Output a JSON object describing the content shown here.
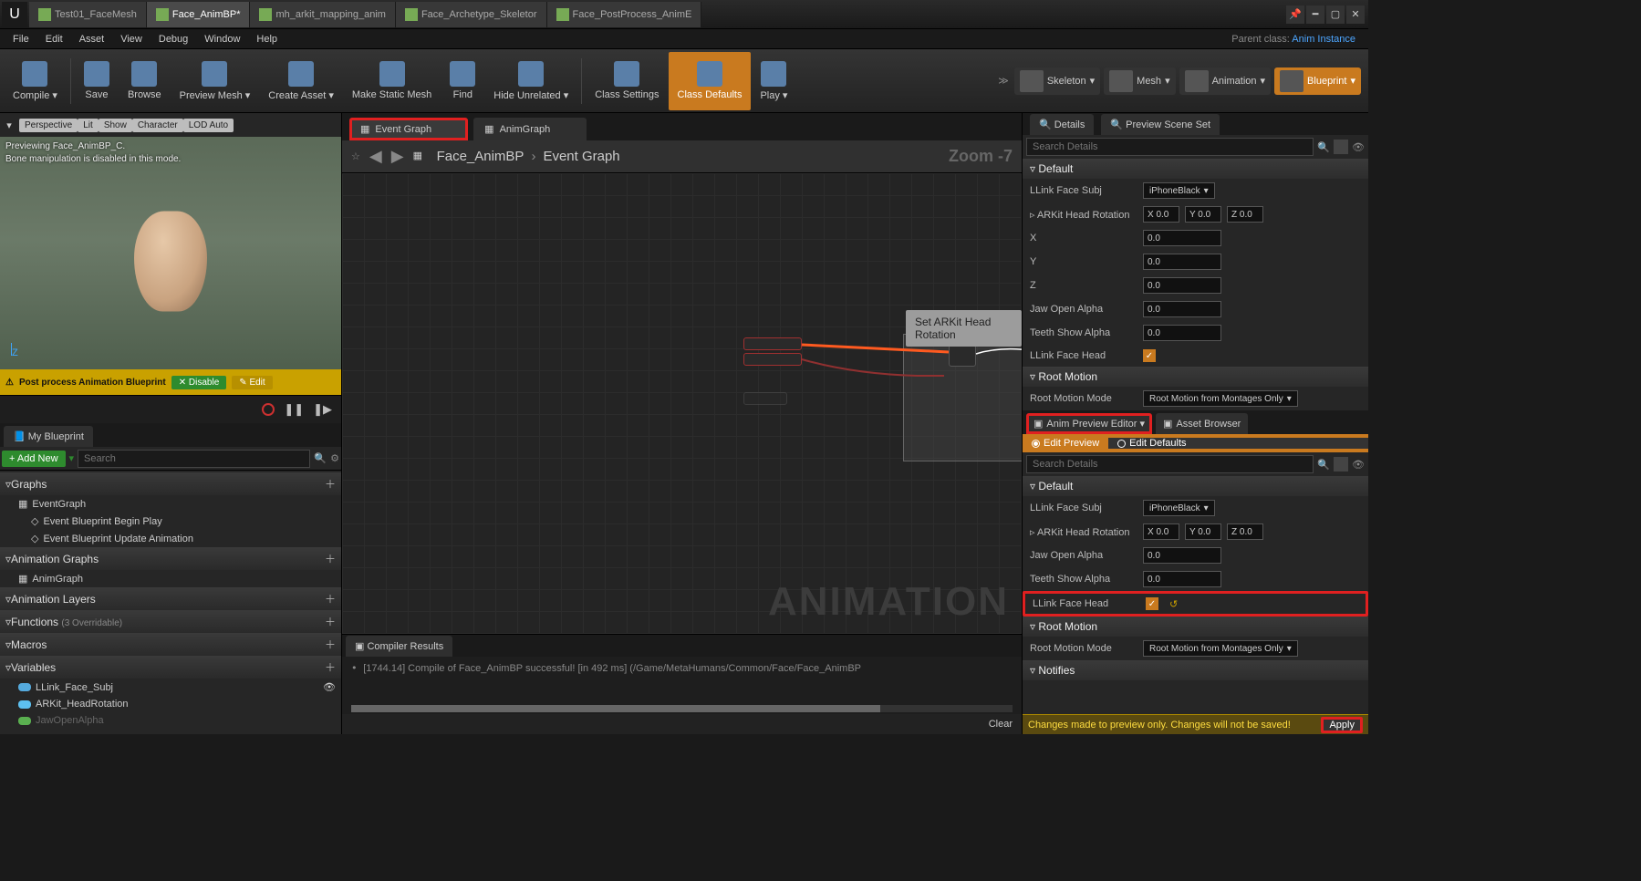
{
  "titleTabs": [
    "Test01_FaceMesh",
    "Face_AnimBP*",
    "mh_arkit_mapping_anim",
    "Face_Archetype_Skeletor",
    "Face_PostProcess_AnimE"
  ],
  "activeTitleTab": 1,
  "menus": [
    "File",
    "Edit",
    "Asset",
    "View",
    "Debug",
    "Window",
    "Help"
  ],
  "parentLabel": "Parent class:",
  "parentLink": "Anim Instance",
  "toolbar": [
    {
      "label": "Compile",
      "drop": true
    },
    {
      "label": "Save"
    },
    {
      "label": "Browse"
    },
    {
      "label": "Preview Mesh",
      "drop": true
    },
    {
      "label": "Create Asset",
      "drop": true
    },
    {
      "label": "Make Static Mesh"
    },
    {
      "label": "Find"
    },
    {
      "label": "Hide Unrelated",
      "drop": true
    },
    {
      "label": "Class Settings"
    },
    {
      "label": "Class Defaults",
      "orange": true
    },
    {
      "label": "Play",
      "drop": true
    }
  ],
  "modes": [
    {
      "label": "Skeleton"
    },
    {
      "label": "Mesh"
    },
    {
      "label": "Animation"
    },
    {
      "label": "Blueprint",
      "active": true
    }
  ],
  "viewport": {
    "chips": [
      "Perspective",
      "Lit",
      "Show",
      "Character",
      "LOD Auto"
    ],
    "overlay1": "Previewing Face_AnimBP_C.",
    "overlay2": "Bone manipulation is disabled in this mode.",
    "axis": "Z",
    "banner": "Post process Animation Blueprint",
    "disable": "Disable",
    "edit": "Edit"
  },
  "myBlueprint": {
    "tabLabel": "My Blueprint",
    "addNew": "+ Add New",
    "search": "Search",
    "sections": [
      {
        "name": "Graphs",
        "items": [
          {
            "label": "EventGraph"
          },
          {
            "label": "Event Blueprint Begin Play",
            "sub": true
          },
          {
            "label": "Event Blueprint Update Animation",
            "sub": true
          }
        ]
      },
      {
        "name": "Animation Graphs",
        "items": [
          {
            "label": "AnimGraph"
          }
        ]
      },
      {
        "name": "Animation Layers",
        "items": []
      },
      {
        "name": "Functions",
        "hint": "(3 Overridable)",
        "items": []
      },
      {
        "name": "Macros",
        "items": []
      },
      {
        "name": "Variables",
        "items": [
          {
            "label": "LLink_Face_Subj",
            "pill": "#55aadd",
            "eye": true
          },
          {
            "label": "ARKit_HeadRotation",
            "pill": "#5dc0f0"
          },
          {
            "label": "JawOpenAlpha",
            "pill": "#5ab050",
            "dim": true
          }
        ]
      }
    ]
  },
  "graph": {
    "tabs": [
      {
        "label": "Event Graph",
        "active": true,
        "hl": true
      },
      {
        "label": "AnimGraph"
      }
    ],
    "crumbHome": "Face_AnimBP",
    "crumbLeaf": "Event Graph",
    "zoom": "Zoom -7",
    "watermark": "ANIMATION",
    "tooltip": "Set ARKit Head Rotation"
  },
  "compiler": {
    "tab": "Compiler Results",
    "log": "[1744.14] Compile of Face_AnimBP successful! [in 492 ms] (/Game/MetaHumans/Common/Face/Face_AnimBP",
    "clear": "Clear"
  },
  "detailsTop": {
    "tabs": [
      "Details",
      "Preview Scene Set"
    ],
    "search": "Search Details",
    "cats": [
      {
        "name": "Default",
        "rows": [
          {
            "label": "LLink Face Subj",
            "type": "combo",
            "value": "iPhoneBlack"
          },
          {
            "label": "ARKit Head Rotation",
            "type": "vec3",
            "x": "X 0.0",
            "y": "Y 0.0",
            "z": "Z 0.0"
          },
          {
            "label": "X",
            "type": "spin",
            "value": "0.0"
          },
          {
            "label": "Y",
            "type": "spin",
            "value": "0.0"
          },
          {
            "label": "Z",
            "type": "spin",
            "value": "0.0"
          },
          {
            "label": "Jaw Open Alpha",
            "type": "spin",
            "value": "0.0"
          },
          {
            "label": "Teeth Show Alpha",
            "type": "spin",
            "value": "0.0"
          },
          {
            "label": "LLink Face Head",
            "type": "check",
            "value": true
          }
        ]
      },
      {
        "name": "Root Motion",
        "rows": [
          {
            "label": "Root Motion Mode",
            "type": "combo",
            "value": "Root Motion from Montages Only"
          }
        ]
      }
    ]
  },
  "animTabs": [
    "Anim Preview Editor",
    "Asset Browser"
  ],
  "editModes": {
    "a": "Edit Preview",
    "b": "Edit Defaults"
  },
  "detailsBottom": {
    "search": "Search Details",
    "cats": [
      {
        "name": "Default",
        "rows": [
          {
            "label": "LLink Face Subj",
            "type": "combo",
            "value": "iPhoneBlack"
          },
          {
            "label": "ARKit Head Rotation",
            "type": "vec3",
            "x": "X 0.0",
            "y": "Y 0.0",
            "z": "Z 0.0"
          },
          {
            "label": "Jaw Open Alpha",
            "type": "spin",
            "value": "0.0"
          },
          {
            "label": "Teeth Show Alpha",
            "type": "spin",
            "value": "0.0"
          },
          {
            "label": "LLink Face Head",
            "type": "check",
            "value": true,
            "hl": true,
            "reset": true
          }
        ]
      },
      {
        "name": "Root Motion",
        "rows": [
          {
            "label": "Root Motion Mode",
            "type": "combo",
            "value": "Root Motion from Montages Only"
          }
        ]
      },
      {
        "name": "Notifies",
        "rows": []
      }
    ]
  },
  "warning": "Changes made to preview only. Changes will not be saved!",
  "apply": "Apply"
}
